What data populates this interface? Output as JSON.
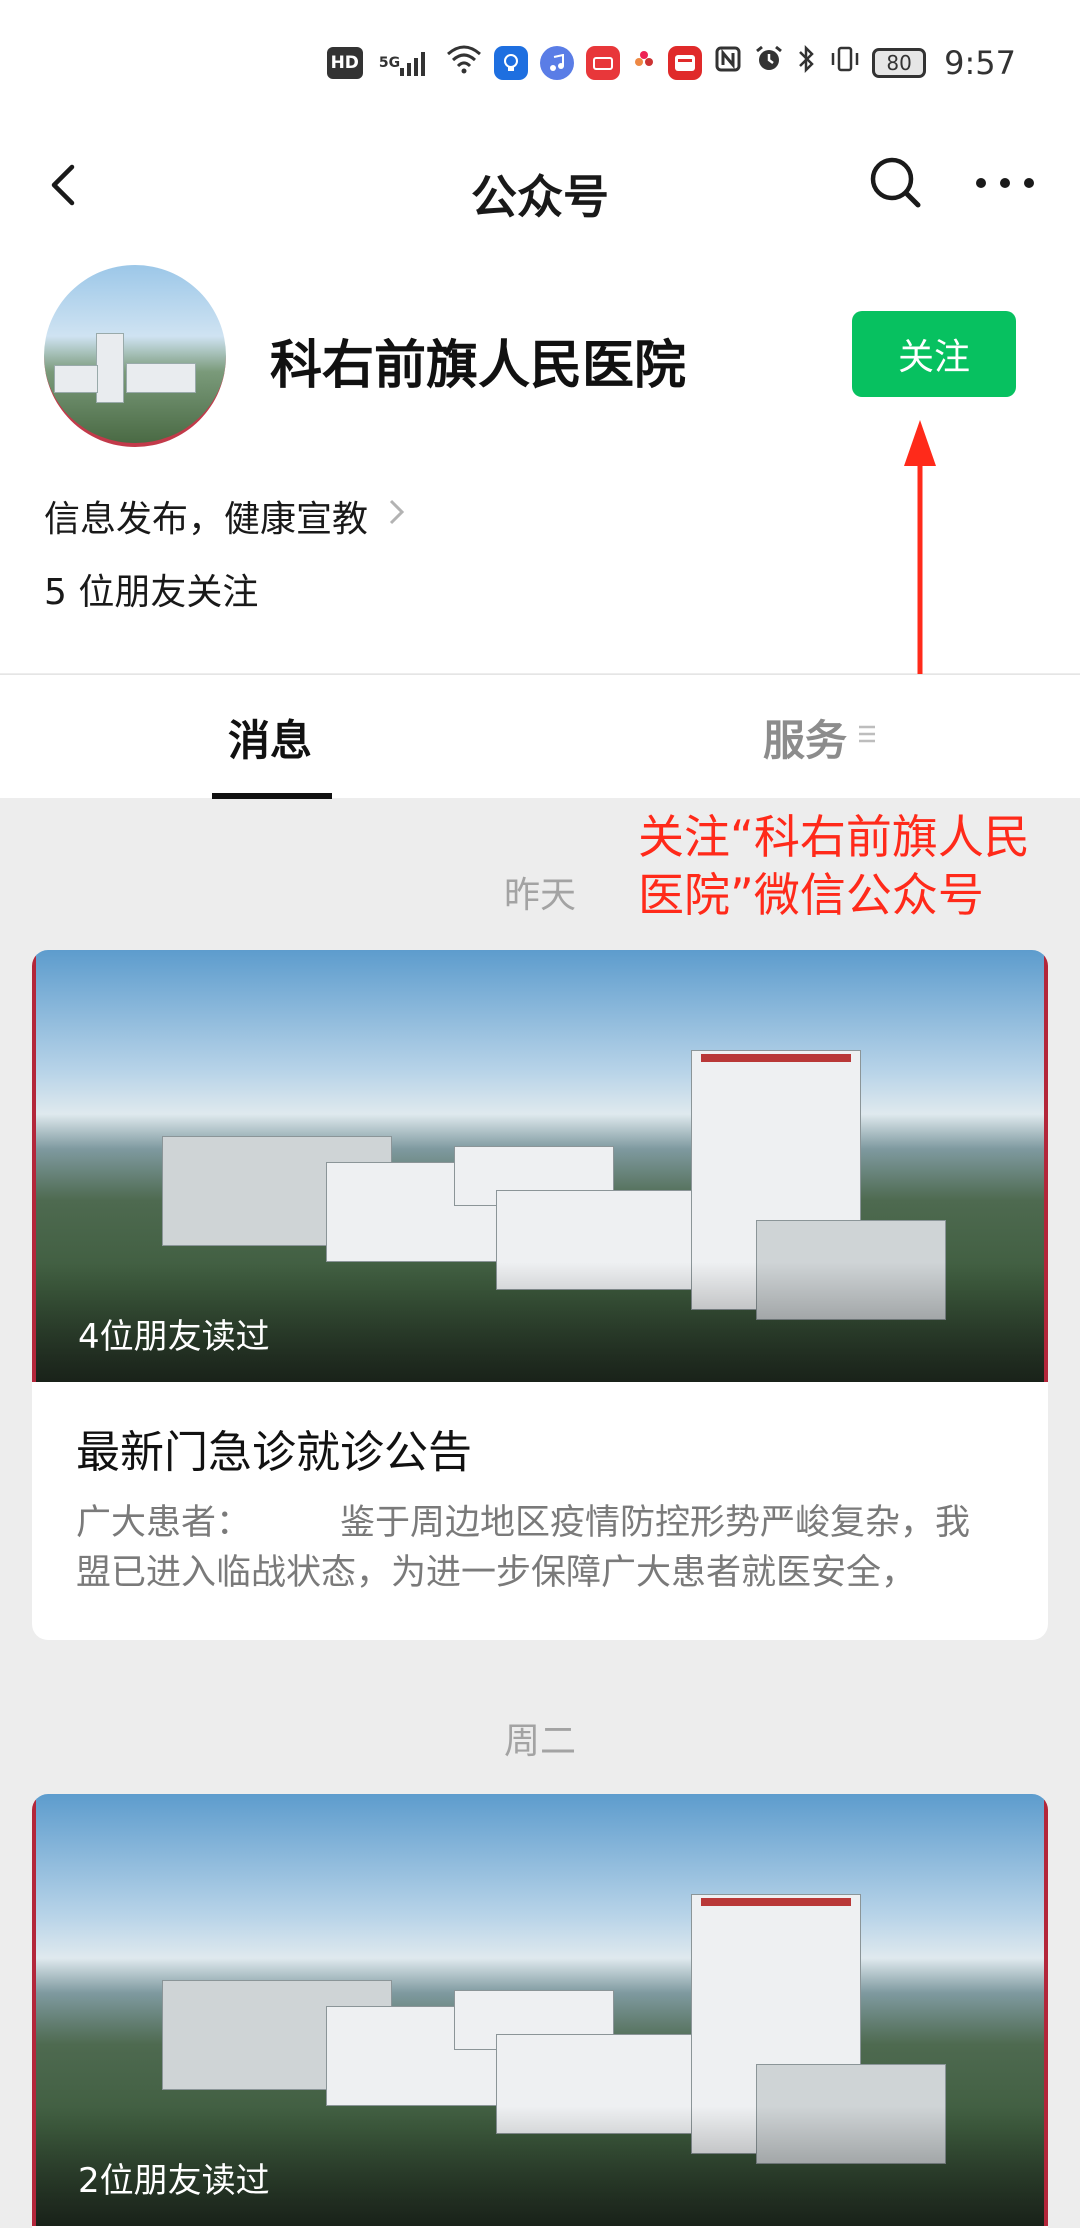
{
  "status_bar": {
    "hd": "HD",
    "network": "5G",
    "battery": "80",
    "time": "9:57"
  },
  "nav": {
    "title": "公众号"
  },
  "profile": {
    "name": "科右前旗人民医院",
    "follow_label": "关注",
    "description": "信息发布，健康宣教",
    "friends_following": "5 位朋友关注"
  },
  "tabs": [
    {
      "label": "消息",
      "active": true
    },
    {
      "label": "服务",
      "active": false
    }
  ],
  "annotation": {
    "text": "关注“科右前旗人民医院”微信公众号",
    "color": "#ff2a1a"
  },
  "messages": [
    {
      "date": "昨天",
      "reads": "4位朋友读过",
      "title": "最新门急诊就诊公告",
      "summary": "广大患者：        鉴于周边地区疫情防控形势严峻复杂，我盟已进入临战状态，为进一步保障广大患者就医安全，"
    },
    {
      "date": "周二",
      "reads": "2位朋友读过"
    }
  ],
  "colors": {
    "accent_green": "#07c160",
    "background": "#ededed"
  }
}
